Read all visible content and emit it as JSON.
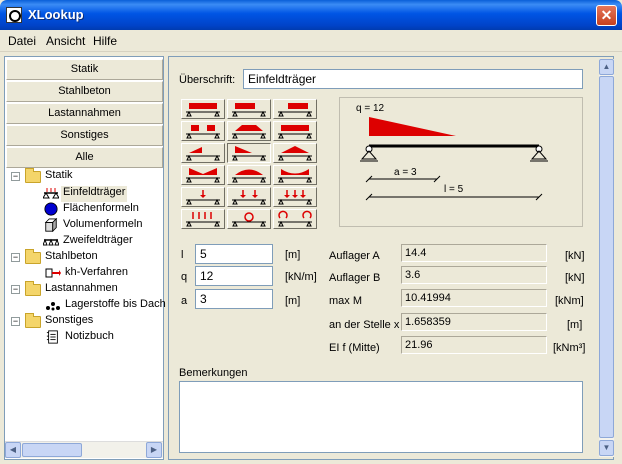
{
  "window": {
    "title": "XLookup",
    "close": "✕"
  },
  "menu": [
    "Datei",
    "Ansicht",
    "Hilfe"
  ],
  "categories": [
    "Statik",
    "Stahlbeton",
    "Lastannahmen",
    "Sonstiges",
    "Alle"
  ],
  "tree": {
    "statik": {
      "label": "Statik",
      "children": [
        "Einfeldträger",
        "Flächenformeln",
        "Volumenformeln",
        "Zweifeldträger"
      ]
    },
    "stahlbeton": {
      "label": "Stahlbeton",
      "children": [
        "kh-Verfahren"
      ]
    },
    "lastannahmen": {
      "label": "Lastannahmen",
      "children": [
        "Lagerstoffe bis Dach"
      ]
    },
    "sonstiges": {
      "label": "Sonstiges",
      "children": [
        "Notizbuch"
      ]
    }
  },
  "form": {
    "heading_label": "Überschrift:",
    "heading_value": "Einfeldträger",
    "inputs": [
      {
        "label": "l",
        "value": "5",
        "unit": "[m]"
      },
      {
        "label": "q",
        "value": "12",
        "unit": "[kN/m]"
      },
      {
        "label": "a",
        "value": "3",
        "unit": "[m]"
      }
    ],
    "results": [
      {
        "label": "Auflager A",
        "value": "14.4",
        "unit": "[kN]"
      },
      {
        "label": "Auflager B",
        "value": "3.6",
        "unit": "[kN]"
      },
      {
        "label": "max M",
        "value": "10.41994",
        "unit": "[kNm]"
      },
      {
        "label": "an der Stelle x",
        "value": "1.658359",
        "unit": "[m]"
      },
      {
        "label": "EI f (Mitte)",
        "value": "21.96",
        "unit": "[kNm³]"
      }
    ],
    "remarks_label": "Bemerkungen",
    "remarks_value": ""
  },
  "diagram": {
    "q_label": "q = 12",
    "a_label": "a = 3",
    "l_label": "l = 5"
  },
  "colors": {
    "load_fill": "#dd0000",
    "accent": "#0055e5"
  }
}
